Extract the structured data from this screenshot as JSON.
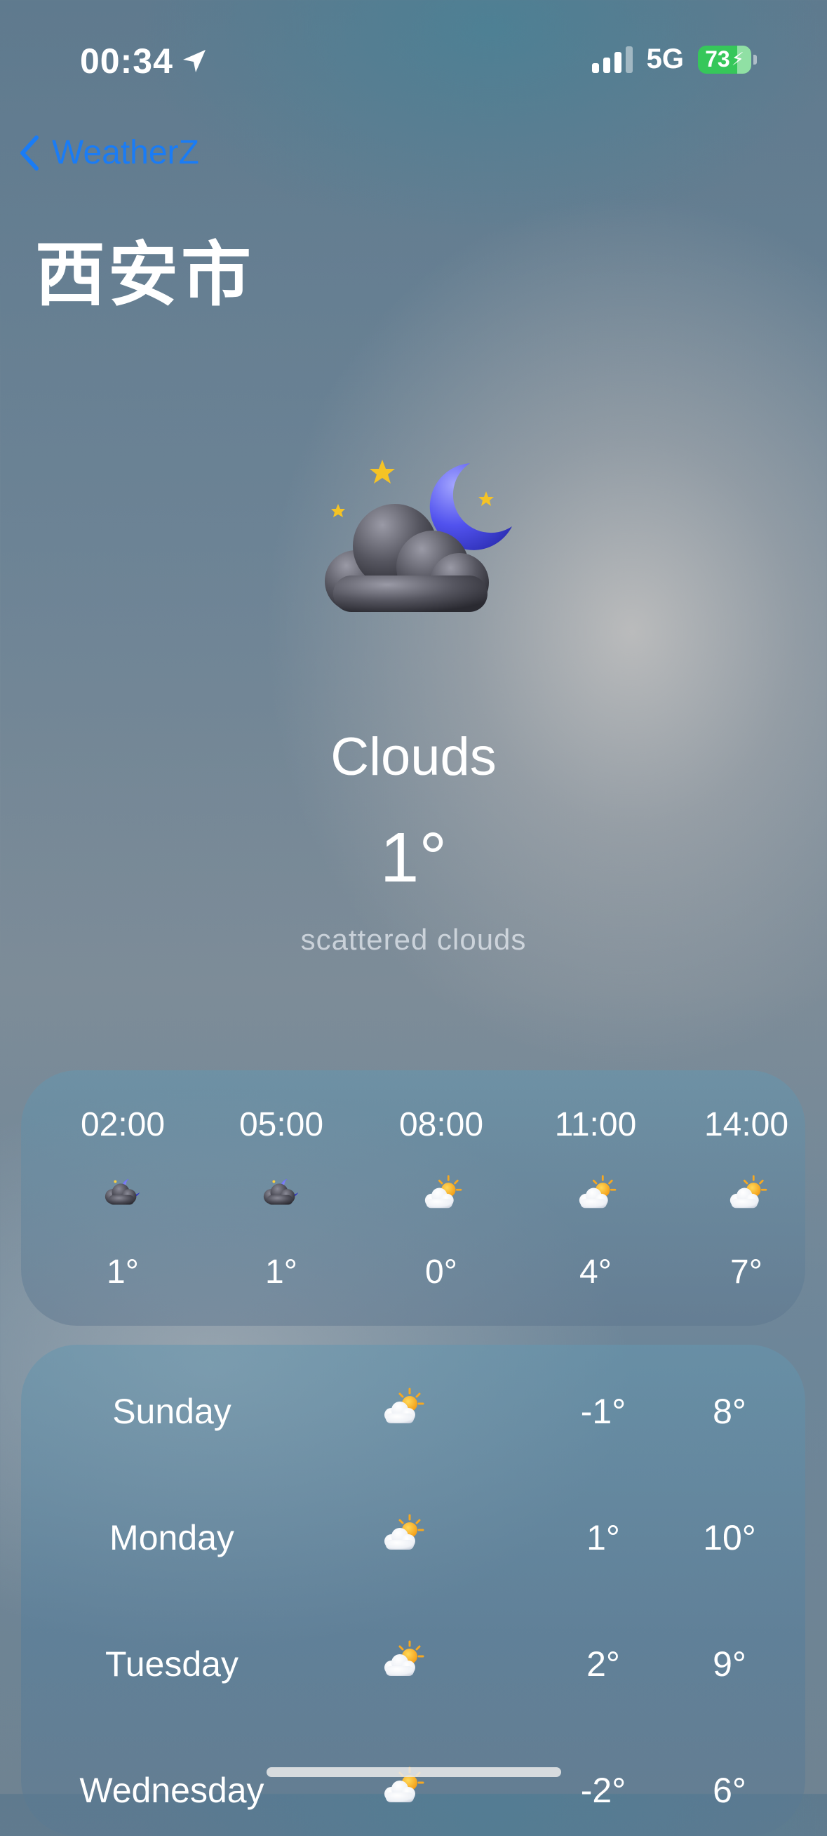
{
  "status_bar": {
    "time": "00:34",
    "network": "5G",
    "battery": "73"
  },
  "nav": {
    "back_label": "WeatherZ"
  },
  "city": "西安市",
  "current": {
    "condition": "Clouds",
    "temperature": "1°",
    "description": "scattered clouds",
    "icon": "cloud-moon-stars-icon"
  },
  "hourly": [
    {
      "time": "02:00",
      "icon": "cloud-moon-icon",
      "temp": "1°"
    },
    {
      "time": "05:00",
      "icon": "cloud-moon-icon",
      "temp": "1°"
    },
    {
      "time": "08:00",
      "icon": "cloud-sun-icon",
      "temp": "0°"
    },
    {
      "time": "11:00",
      "icon": "cloud-sun-icon",
      "temp": "4°"
    },
    {
      "time": "14:00",
      "icon": "cloud-sun-icon",
      "temp": "7°"
    }
  ],
  "daily": [
    {
      "day": "Sunday",
      "icon": "cloud-sun-icon",
      "low": "-1°",
      "high": "8°"
    },
    {
      "day": "Monday",
      "icon": "cloud-sun-icon",
      "low": "1°",
      "high": "10°"
    },
    {
      "day": "Tuesday",
      "icon": "cloud-sun-icon",
      "low": "2°",
      "high": "9°"
    },
    {
      "day": "Wednesday",
      "icon": "cloud-sun-icon",
      "low": "-2°",
      "high": "6°"
    }
  ],
  "colors": {
    "accent": "#1a7cf5",
    "battery": "#36c75a",
    "moon": "#5b5cf0",
    "sun": "#f6a821"
  }
}
